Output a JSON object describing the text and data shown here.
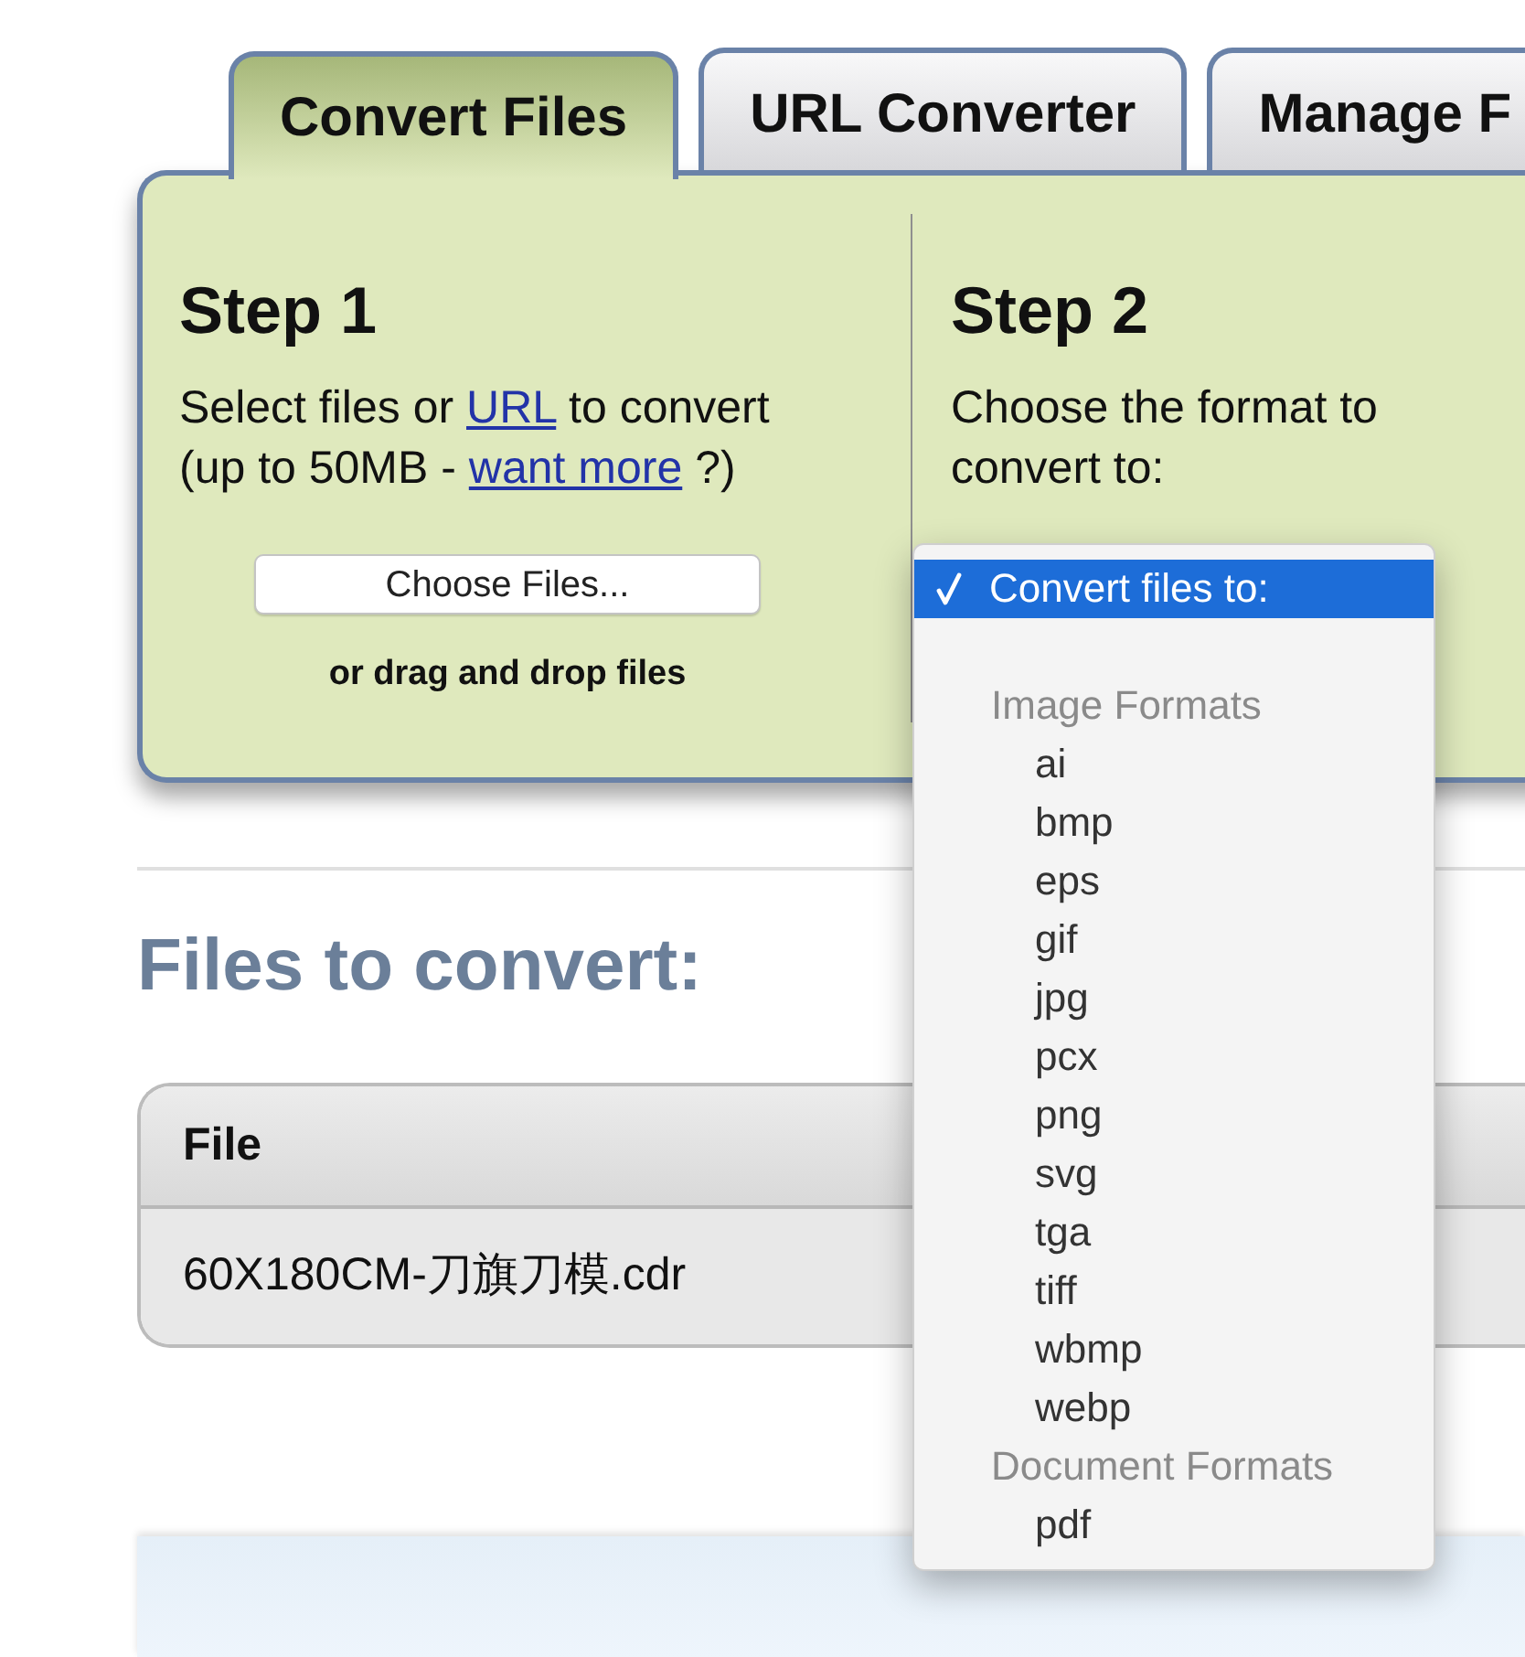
{
  "tabs": [
    {
      "label": "Convert Files",
      "selected": true
    },
    {
      "label": "URL Converter",
      "selected": false
    },
    {
      "label": "Manage F",
      "selected": false
    }
  ],
  "step_1": {
    "title": "Step 1",
    "instructions": [
      {
        "kind": "text",
        "text": "Select files or "
      },
      {
        "kind": "link",
        "text": "URL"
      },
      {
        "kind": "text",
        "text": " to convert (up to 50MB - "
      },
      {
        "kind": "link",
        "text": "want more"
      },
      {
        "kind": "text",
        "text": " ?)"
      }
    ],
    "button": "Choose Files...",
    "hint": "or drag and drop files"
  },
  "step_2": {
    "title": "Step 2",
    "instructions": [
      {
        "kind": "text",
        "text": "Choose the format to convert to:"
      }
    ]
  },
  "format_menu": {
    "options": [
      {
        "label": "Convert files to:",
        "selected": true
      }
    ],
    "groups": [
      {
        "label": "Image Formats",
        "options": [
          {
            "label": "ai",
            "selected": false
          },
          {
            "label": "bmp",
            "selected": false
          },
          {
            "label": "eps",
            "selected": false
          },
          {
            "label": "gif",
            "selected": false
          },
          {
            "label": "jpg",
            "selected": false
          },
          {
            "label": "pcx",
            "selected": false
          },
          {
            "label": "png",
            "selected": false
          },
          {
            "label": "svg",
            "selected": false
          },
          {
            "label": "tga",
            "selected": false
          },
          {
            "label": "tiff",
            "selected": false
          },
          {
            "label": "wbmp",
            "selected": false
          },
          {
            "label": "webp",
            "selected": false
          }
        ]
      },
      {
        "label": "Document Formats",
        "options": [
          {
            "label": "pdf",
            "selected": false
          }
        ]
      }
    ]
  },
  "files_section": {
    "title": "Files to convert:",
    "table": {
      "columns": [
        "File"
      ],
      "rows": [
        [
          "60X180CM-刀旗刀模.cdr"
        ]
      ]
    }
  }
}
